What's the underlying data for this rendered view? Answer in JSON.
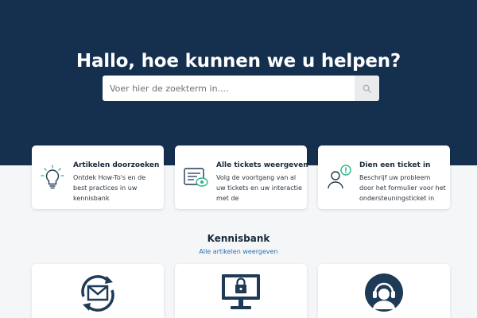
{
  "hero": {
    "title": "Hallo, hoe kunnen we u helpen?",
    "search_placeholder": "Voer hier de zoekterm in...."
  },
  "cards": [
    {
      "title": "Artikelen doorzoeken",
      "description": "Ontdek How-To's en de best practices in uw kennisbank",
      "icon": "lightbulb-icon"
    },
    {
      "title": "Alle tickets weergeven",
      "description": "Volg de voortgang van al uw tickets en uw interactie met de ondersteuningsteams",
      "icon": "ticket-view-icon"
    },
    {
      "title": "Dien een ticket in",
      "description": "Beschrijf uw probleem door het formulier voor het ondersteuningsticket in te…",
      "icon": "user-alert-icon"
    }
  ],
  "knowledge_base": {
    "title": "Kennisbank",
    "view_all_label": "Alle artikelen weergeven",
    "categories": [
      {
        "icon": "mail-sync-icon"
      },
      {
        "icon": "secure-monitor-icon"
      },
      {
        "icon": "headset-support-icon"
      }
    ]
  },
  "colors": {
    "hero_bg": "#14304e",
    "accent_green": "#2fb58a",
    "link_blue": "#2a6fb8",
    "icon_navy": "#1f3a56"
  }
}
